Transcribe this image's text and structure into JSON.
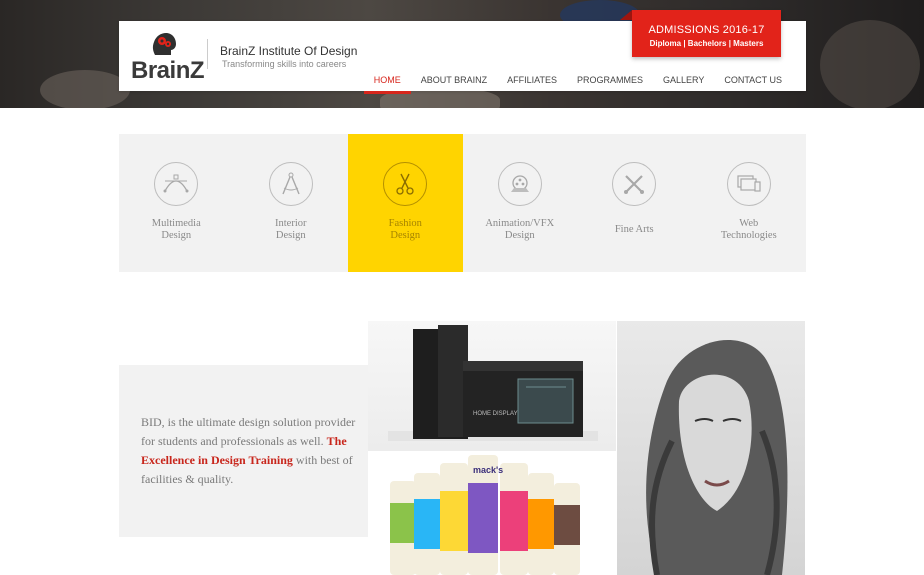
{
  "header": {
    "logo_text": "BrainZ",
    "institute_name": "BrainZ Institute Of Design",
    "tagline": "Transforming skills into careers"
  },
  "admissions": {
    "title": "ADMISSIONS 2016-17",
    "subtitle": "Diploma | Bachelors | Masters"
  },
  "nav": {
    "items": [
      {
        "label": "HOME",
        "active": true
      },
      {
        "label": "ABOUT BRAINZ",
        "active": false
      },
      {
        "label": "AFFILIATES",
        "active": false
      },
      {
        "label": "PROGRAMMES",
        "active": false
      },
      {
        "label": "GALLERY",
        "active": false
      },
      {
        "label": "CONTACT US",
        "active": false
      }
    ]
  },
  "courses": [
    {
      "line1": "Multimedia",
      "line2": "Design",
      "icon": "vector-pen-icon",
      "active": false
    },
    {
      "line1": "Interior",
      "line2": "Design",
      "icon": "compass-icon",
      "active": false
    },
    {
      "line1": "Fashion",
      "line2": "Design",
      "icon": "scissors-icon",
      "active": true
    },
    {
      "line1": "Animation/VFX",
      "line2": "Design",
      "icon": "film-reel-icon",
      "active": false
    },
    {
      "line1": "Fine Arts",
      "line2": "",
      "icon": "brushes-icon",
      "active": false
    },
    {
      "line1": "Web",
      "line2": "Technologies",
      "icon": "devices-icon",
      "active": false
    }
  ],
  "intro": {
    "text_before": "BID, is the ultimate design solution provider for students and professionals as well. ",
    "highlight": "The Excellence in Design Training",
    "text_after": " with best of facilities & quality."
  },
  "product_box": {
    "box_label": "HOME DISPLAY"
  },
  "cans": {
    "brand": "mack's"
  },
  "colors": {
    "accent_red": "#e2231a",
    "active_yellow": "#ffd400",
    "panel_gray": "#f2f2f2"
  }
}
